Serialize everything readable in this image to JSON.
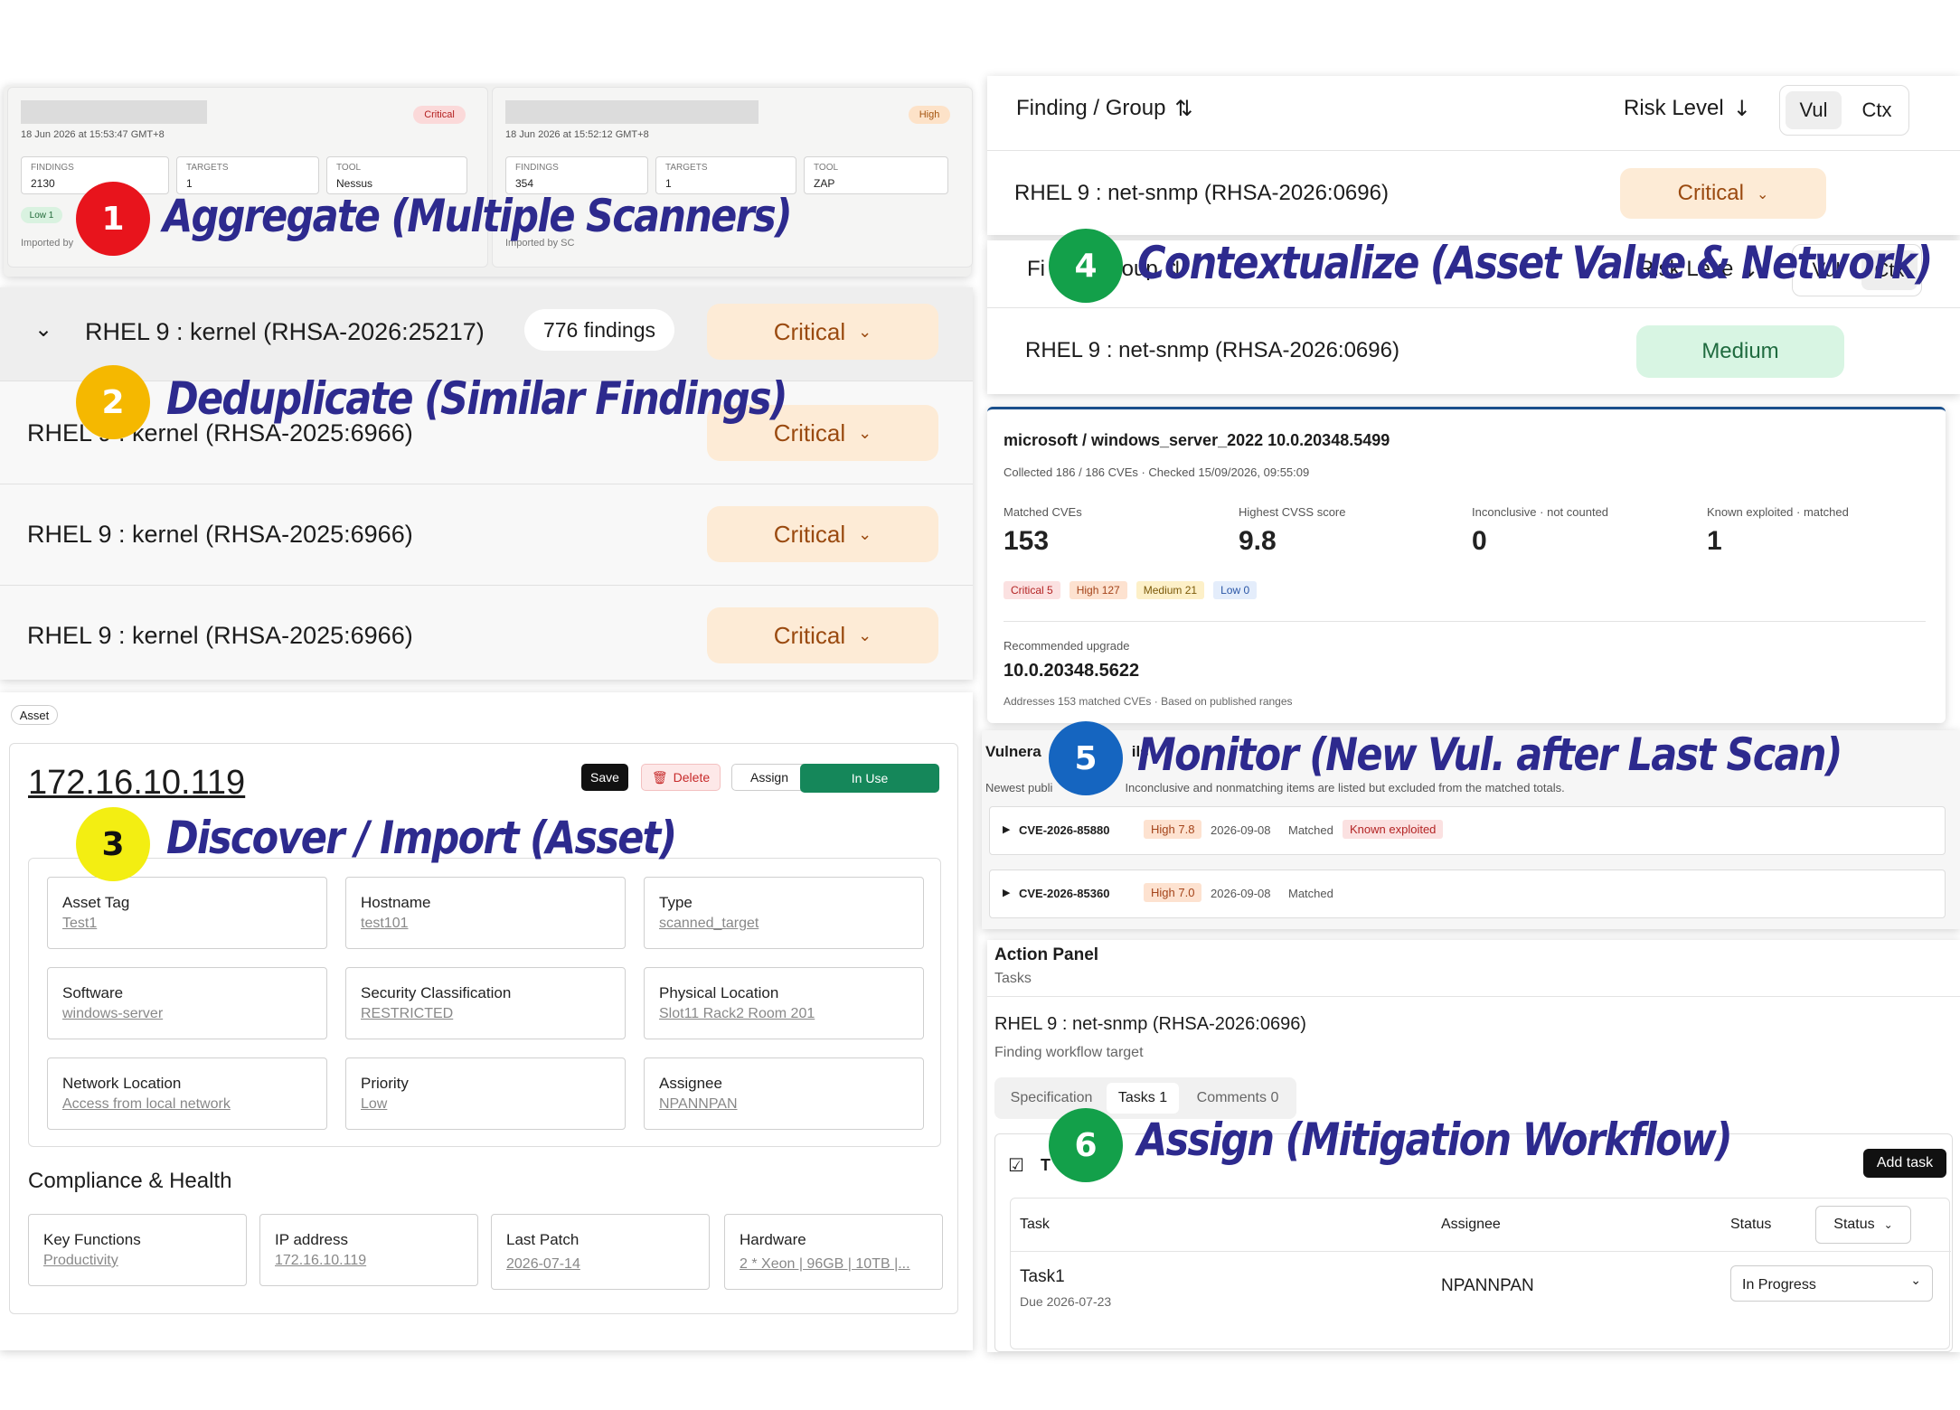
{
  "aggregate": {
    "cards": [
      {
        "badge": "Critical",
        "timestamp": "18 Jun 2026 at 15:53:47 GMT+8",
        "findings_label": "FINDINGS",
        "findings": "2130",
        "targets_label": "TARGETS",
        "targets": "1",
        "tool_label": "TOOL",
        "tool": "Nessus",
        "chip": "Low 1",
        "imported": "Imported by"
      },
      {
        "badge": "High",
        "timestamp": "18 Jun 2026 at 15:52:12 GMT+8",
        "findings_label": "FINDINGS",
        "findings": "354",
        "targets_label": "TARGETS",
        "targets": "1",
        "tool_label": "TOOL",
        "tool": "ZAP",
        "chip": "",
        "imported": "Imported by SC"
      }
    ]
  },
  "dedupe": {
    "group_title": "RHEL 9 : kernel (RHSA-2026:25217)",
    "group_count": "776 findings",
    "group_level": "Critical",
    "rows": [
      {
        "title": "RHEL 9 : kernel (RHSA-2025:6966)",
        "level": "Critical"
      },
      {
        "title": "RHEL 9 : kernel (RHSA-2025:6966)",
        "level": "Critical"
      },
      {
        "title": "RHEL 9 : kernel (RHSA-2025:6966)",
        "level": "Critical"
      }
    ]
  },
  "asset": {
    "tag": "Asset",
    "ip": "172.16.10.119",
    "save": "Save",
    "delete": "Delete",
    "assign": "Assign",
    "status": "In Use",
    "fields": [
      {
        "label": "Asset Tag",
        "value": "Test1"
      },
      {
        "label": "Hostname",
        "value": "test101"
      },
      {
        "label": "Type",
        "value": "scanned_target"
      },
      {
        "label": "Software",
        "value": "windows-server"
      },
      {
        "label": "Security Classification",
        "value": "RESTRICTED"
      },
      {
        "label": "Physical Location",
        "value": "Slot11 Rack2 Room 201"
      },
      {
        "label": "Network Location",
        "value": "Access from local network"
      },
      {
        "label": "Priority",
        "value": "Low"
      },
      {
        "label": "Assignee",
        "value": "NPANNPAN"
      }
    ],
    "compliance_title": "Compliance & Health",
    "compliance": [
      {
        "label": "Key Functions",
        "value": "Productivity"
      },
      {
        "label": "IP address",
        "value": "172.16.10.119"
      },
      {
        "label": "Last Patch",
        "value": "2026-07-14"
      },
      {
        "label": "Hardware",
        "value": "2 * Xeon | 96GB | 10TB |..."
      }
    ]
  },
  "context": {
    "header_finding": "Finding / Group",
    "header_risk": "Risk Level",
    "toggle_vul": "Vul",
    "toggle_ctx": "Ctx",
    "row_before": {
      "title": "RHEL 9 : net-snmp (RHSA-2026:0696)",
      "level": "Critical"
    },
    "header2_finding": "Fi",
    "header2_group": "Group",
    "header2_risk": "Risk Leve",
    "toggle2_vul": "Vul",
    "toggle2_ctx": "Ctx",
    "row_after": {
      "title": "RHEL 9 : net-snmp (RHSA-2026:0696)",
      "level": "Medium"
    }
  },
  "monitor": {
    "product": "microsoft / windows_server_2022 10.0.20348.5499",
    "collected": "Collected 186 / 186 CVEs · Checked 15/09/2026, 09:55:09",
    "stats": [
      {
        "label": "Matched CVEs",
        "value": "153"
      },
      {
        "label": "Highest CVSS score",
        "value": "9.8"
      },
      {
        "label": "Inconclusive · not counted",
        "value": "0"
      },
      {
        "label": "Known exploited · matched",
        "value": "1"
      }
    ],
    "sev_chips": [
      "Critical 5",
      "High 127",
      "Medium 21",
      "Low 0"
    ],
    "upgrade_label": "Recommended upgrade",
    "upgrade_value": "10.0.20348.5622",
    "upgrade_note": "Addresses 153 matched CVEs · Based on published ranges",
    "vuln_title_a": "Vulnera",
    "vuln_title_b": "ils",
    "vuln_sub_a": "Newest publi",
    "vuln_sub_b": "Inconclusive and nonmatching items are listed but excluded from the matched totals.",
    "cves": [
      {
        "id": "CVE-2026-85880",
        "score": "High 7.8",
        "date": "2026-09-08",
        "status": "Matched",
        "flag": "Known exploited"
      },
      {
        "id": "CVE-2026-85360",
        "score": "High 7.0",
        "date": "2026-09-08",
        "status": "Matched",
        "flag": ""
      }
    ]
  },
  "workflow": {
    "title": "Action Panel",
    "subtitle": "Tasks",
    "finding": "RHEL 9 : net-snmp (RHSA-2026:0696)",
    "finding_sub": "Finding workflow target",
    "tabs": [
      "Specification",
      "Tasks 1",
      "Comments 0"
    ],
    "tasks_prefix": "T",
    "add_task": "Add task",
    "col_task": "Task",
    "col_assignee": "Assignee",
    "col_status": "Status",
    "status_filter": "Status",
    "row": {
      "task": "Task1",
      "due": "Due 2026-07-23",
      "assignee": "NPANNPAN",
      "status": "In Progress"
    }
  },
  "callouts": [
    {
      "num": "1",
      "text": "Aggregate (Multiple Scanners)"
    },
    {
      "num": "2",
      "text": "Deduplicate (Similar Findings)"
    },
    {
      "num": "3",
      "text": "Discover / Import  (Asset)"
    },
    {
      "num": "4",
      "text": "Contextualize (Asset Value & Network)"
    },
    {
      "num": "5",
      "text": "Monitor (New Vul. after Last Scan)"
    },
    {
      "num": "6",
      "text": "Assign (Mitigation Workflow)"
    }
  ],
  "colors": {
    "callout1": "#e8141c",
    "callout2": "#f5b800",
    "callout3": "#f3ee12",
    "callout4": "#13a04a",
    "callout5": "#1565c0",
    "callout6": "#13a04a",
    "callout_text": "#2d2a8e",
    "critical_bg": "#fdebd6",
    "medium_bg": "#d8f5e3",
    "inuse": "#15875a"
  }
}
